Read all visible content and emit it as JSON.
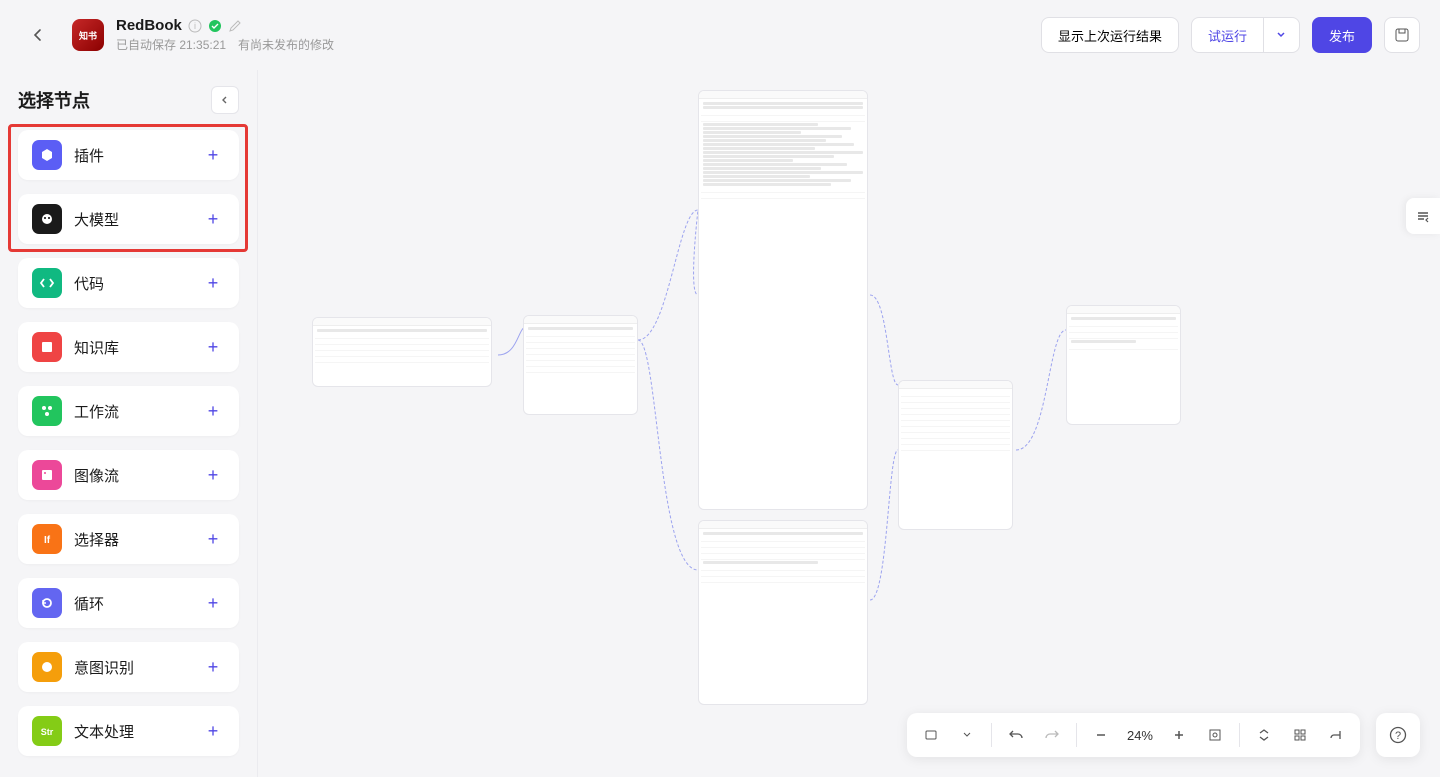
{
  "header": {
    "app_name": "RedBook",
    "save_status": "已自动保存 21:35:21",
    "unpublished": "有尚未发布的修改",
    "btn_show_last_run": "显示上次运行结果",
    "btn_test_run": "试运行",
    "btn_publish": "发布"
  },
  "sidebar": {
    "title": "选择节点",
    "items": [
      {
        "label": "插件",
        "icon_class": "ic-plugin"
      },
      {
        "label": "大模型",
        "icon_class": "ic-llm"
      },
      {
        "label": "代码",
        "icon_class": "ic-code"
      },
      {
        "label": "知识库",
        "icon_class": "ic-kb"
      },
      {
        "label": "工作流",
        "icon_class": "ic-wf"
      },
      {
        "label": "图像流",
        "icon_class": "ic-img"
      },
      {
        "label": "选择器",
        "icon_class": "ic-sel"
      },
      {
        "label": "循环",
        "icon_class": "ic-loop"
      },
      {
        "label": "意图识别",
        "icon_class": "ic-intent"
      },
      {
        "label": "文本处理",
        "icon_class": "ic-text"
      }
    ]
  },
  "toolbar": {
    "zoom": "24%"
  }
}
